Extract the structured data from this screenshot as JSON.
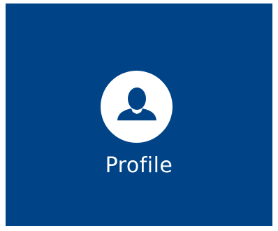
{
  "tile": {
    "label": "Profile",
    "icon": "user-icon",
    "background_color": "#004387",
    "icon_circle_color": "#ffffff",
    "icon_color": "#004387"
  }
}
